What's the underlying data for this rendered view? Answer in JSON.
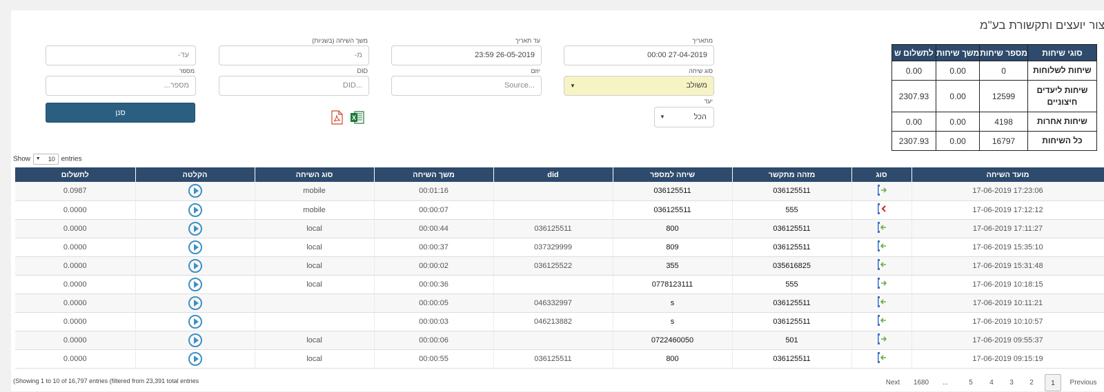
{
  "company_title": "צור יועצים ותקשורת בע\"מ",
  "summary": {
    "headers": [
      "סוגי שיחות",
      "מספר שיחות",
      "משך שיחות",
      "לתשלום ש"
    ],
    "rows": [
      {
        "label": "שיחות לשלוחות",
        "count": "0",
        "duration": "0.00",
        "pay": "0.00"
      },
      {
        "label": "שיחות ליעדים חיצוניים",
        "count": "12599",
        "duration": "0.00",
        "pay": "2307.93"
      },
      {
        "label": "שיחות אחרות",
        "count": "4198",
        "duration": "0.00",
        "pay": "0.00"
      },
      {
        "label": "כל השיחות",
        "count": "16797",
        "duration": "0.00",
        "pay": "2307.93"
      }
    ]
  },
  "filters": {
    "from_date": {
      "label": "מתאריך",
      "value": "27-04-2019 00:00"
    },
    "to_date": {
      "label": "עד תאריך",
      "value": "26-05-2019 23:59"
    },
    "duration": {
      "label": "משך השיחה (בשניות)",
      "from_placeholder": "מ-",
      "to_placeholder": "עד-"
    },
    "call_type": {
      "label": "סוג שיחה",
      "value": "משולב"
    },
    "initiator": {
      "label": "יוזם",
      "placeholder": "Source..."
    },
    "did": {
      "label": "DID",
      "placeholder": "DID..."
    },
    "number": {
      "label": "מספר",
      "placeholder": "מספר..."
    },
    "destination": {
      "label": "יעד",
      "value": "הכל"
    },
    "scan_button": "סנן"
  },
  "length_menu": {
    "show": "Show",
    "value": "10",
    "entries": "entries"
  },
  "table": {
    "headers": [
      "מועד השיחה",
      "סוג",
      "מזהה מתקשר",
      "שיחה למספר",
      "did",
      "משך השיחה",
      "סוג השיחה",
      "הקלטה",
      "לתשלום"
    ],
    "rows": [
      {
        "time": "17-06-2019 17:23:06",
        "dir": "out",
        "caller": "036125511",
        "to": "036125511",
        "did": "",
        "duration": "00:01:16",
        "type": "mobile",
        "pay": "0.0987"
      },
      {
        "time": "17-06-2019 17:12:12",
        "dir": "missed",
        "caller": "555",
        "to": "036125511",
        "did": "",
        "duration": "00:00:07",
        "type": "mobile",
        "pay": "0.0000"
      },
      {
        "time": "17-06-2019 17:11:27",
        "dir": "in",
        "caller": "036125511",
        "to": "800",
        "did": "036125511",
        "duration": "00:00:44",
        "type": "local",
        "pay": "0.0000"
      },
      {
        "time": "17-06-2019 15:35:10",
        "dir": "in",
        "caller": "036125511",
        "to": "809",
        "did": "037329999",
        "duration": "00:00:37",
        "type": "local",
        "pay": "0.0000"
      },
      {
        "time": "17-06-2019 15:31:48",
        "dir": "in",
        "caller": "035616825",
        "to": "355",
        "did": "036125522",
        "duration": "00:00:02",
        "type": "local",
        "pay": "0.0000"
      },
      {
        "time": "17-06-2019 10:18:15",
        "dir": "out",
        "caller": "555",
        "to": "0778123111",
        "did": "",
        "duration": "00:00:36",
        "type": "local",
        "pay": "0.0000"
      },
      {
        "time": "17-06-2019 10:11:21",
        "dir": "in",
        "caller": "036125511",
        "to": "s",
        "did": "046332997",
        "duration": "00:00:05",
        "type": "",
        "pay": "0.0000"
      },
      {
        "time": "17-06-2019 10:10:57",
        "dir": "in",
        "caller": "036125511",
        "to": "s",
        "did": "046213882",
        "duration": "00:00:03",
        "type": "",
        "pay": "0.0000"
      },
      {
        "time": "17-06-2019 09:55:37",
        "dir": "out",
        "caller": "501",
        "to": "0722460050",
        "did": "",
        "duration": "00:00:06",
        "type": "local",
        "pay": "0.0000"
      },
      {
        "time": "17-06-2019 09:15:19",
        "dir": "in",
        "caller": "036125511",
        "to": "800",
        "did": "036125511",
        "duration": "00:00:55",
        "type": "local",
        "pay": "0.0000"
      }
    ]
  },
  "info_text": "(Showing 1 to 10 of 16,797 entries (filtered from 23,391 total entries",
  "pagination": {
    "previous": "Previous",
    "pages": [
      "1",
      "2",
      "3",
      "4",
      "5",
      "...",
      "1680"
    ],
    "next": "Next",
    "current": "1"
  },
  "colors": {
    "header_bg": "#2e4a6c",
    "button_bg": "#2b5f82",
    "play": "#3d8fc4",
    "phone_icon": "#3d6fc4",
    "arrow_green": "#6ab04c",
    "missed_red": "#d42020",
    "yellow_select": "#f6f3c4"
  }
}
